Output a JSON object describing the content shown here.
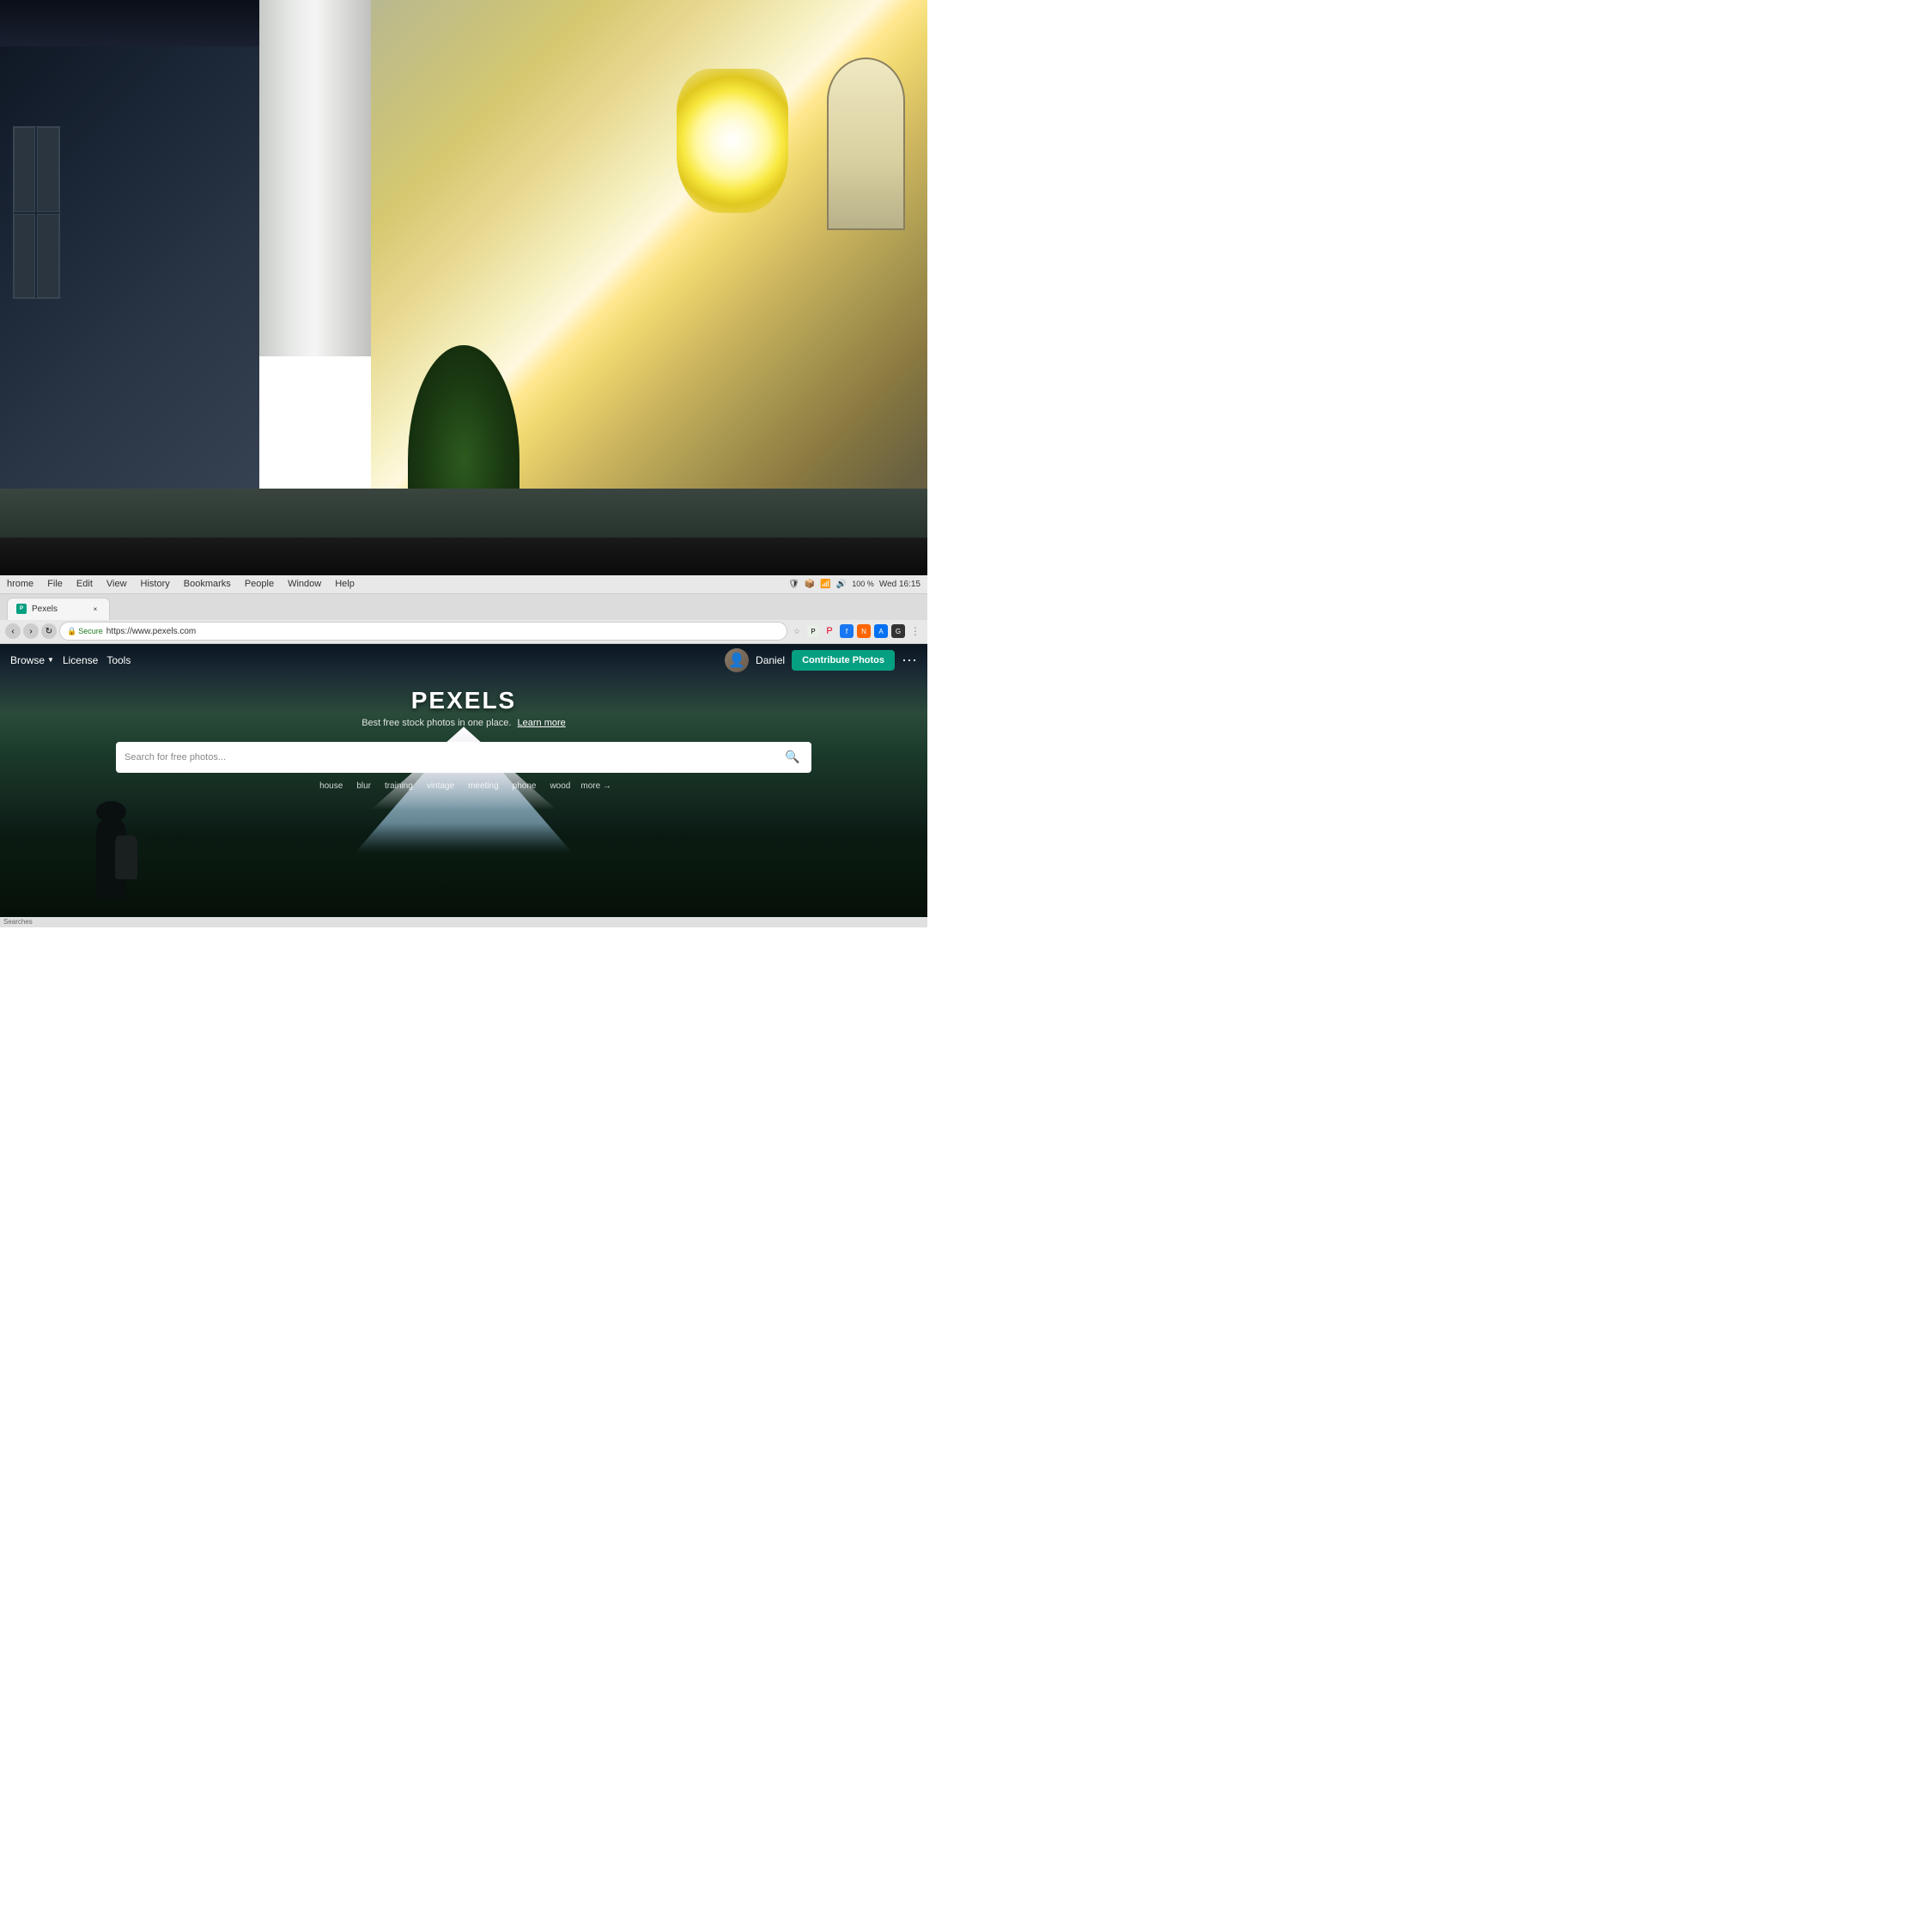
{
  "background": {
    "alt": "Office space with concrete pillar, large windows, plant, blurred background"
  },
  "browser": {
    "menu_items": [
      "hrome",
      "File",
      "Edit",
      "View",
      "History",
      "Bookmarks",
      "People",
      "Window",
      "Help"
    ],
    "status_bar": {
      "battery": "100 %",
      "time": "Wed 16:15"
    },
    "tab": {
      "title": "Pexels",
      "favicon": "P"
    },
    "close_button": "×",
    "address": {
      "secure_label": "Secure",
      "url": "https://www.pexels.com"
    },
    "nav": {
      "back": "‹",
      "forward": "›",
      "reload": "↻"
    }
  },
  "pexels": {
    "nav": {
      "browse_label": "Browse",
      "license_label": "License",
      "tools_label": "Tools",
      "user_name": "Daniel",
      "contribute_label": "Contribute Photos",
      "more_label": "···"
    },
    "hero": {
      "logo": "PEXELS",
      "tagline": "Best free stock photos in one place.",
      "learn_more": "Learn more",
      "search_placeholder": "Search for free photos..."
    },
    "tags": [
      "house",
      "blur",
      "training",
      "vintage",
      "meeting",
      "phone",
      "wood",
      "more →"
    ]
  },
  "status_bar": {
    "text": "Searches"
  },
  "colors": {
    "pexels_green": "#05a081",
    "secure_green": "#1a7a1a",
    "browser_bg": "#f0f0f0",
    "nav_bg": "#f5f5f5",
    "tab_bg": "#f5f5f5",
    "menu_bar_bg": "#e8e8e8"
  }
}
